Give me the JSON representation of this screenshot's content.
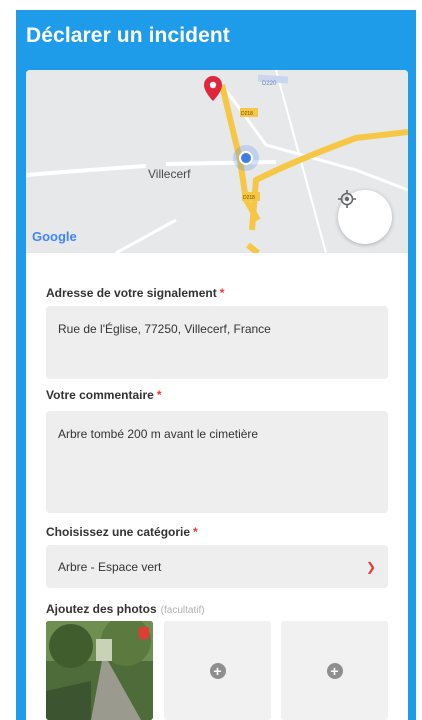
{
  "header": {
    "title": "Déclarer un incident"
  },
  "map": {
    "town_label": "Villecerf",
    "provider_logo": "Google",
    "road_labels": [
      "D220",
      "D218",
      "D218"
    ],
    "locate_icon": "target-icon"
  },
  "form": {
    "address": {
      "label": "Adresse de votre signalement",
      "required_mark": "*",
      "value": "Rue de l'Église, 77250, Villecerf, France"
    },
    "comment": {
      "label": "Votre commentaire",
      "required_mark": "*",
      "value": "Arbre tombé 200 m avant le cimetière"
    },
    "category": {
      "label": "Choisissez une catégorie",
      "required_mark": "*",
      "selected": "Arbre - Espace vert"
    },
    "photos": {
      "label": "Ajoutez des photos",
      "optional_note": "(facultatif)"
    }
  },
  "colors": {
    "primary": "#1e9be9",
    "required": "#e53935",
    "field_bg": "#eeeeee"
  }
}
